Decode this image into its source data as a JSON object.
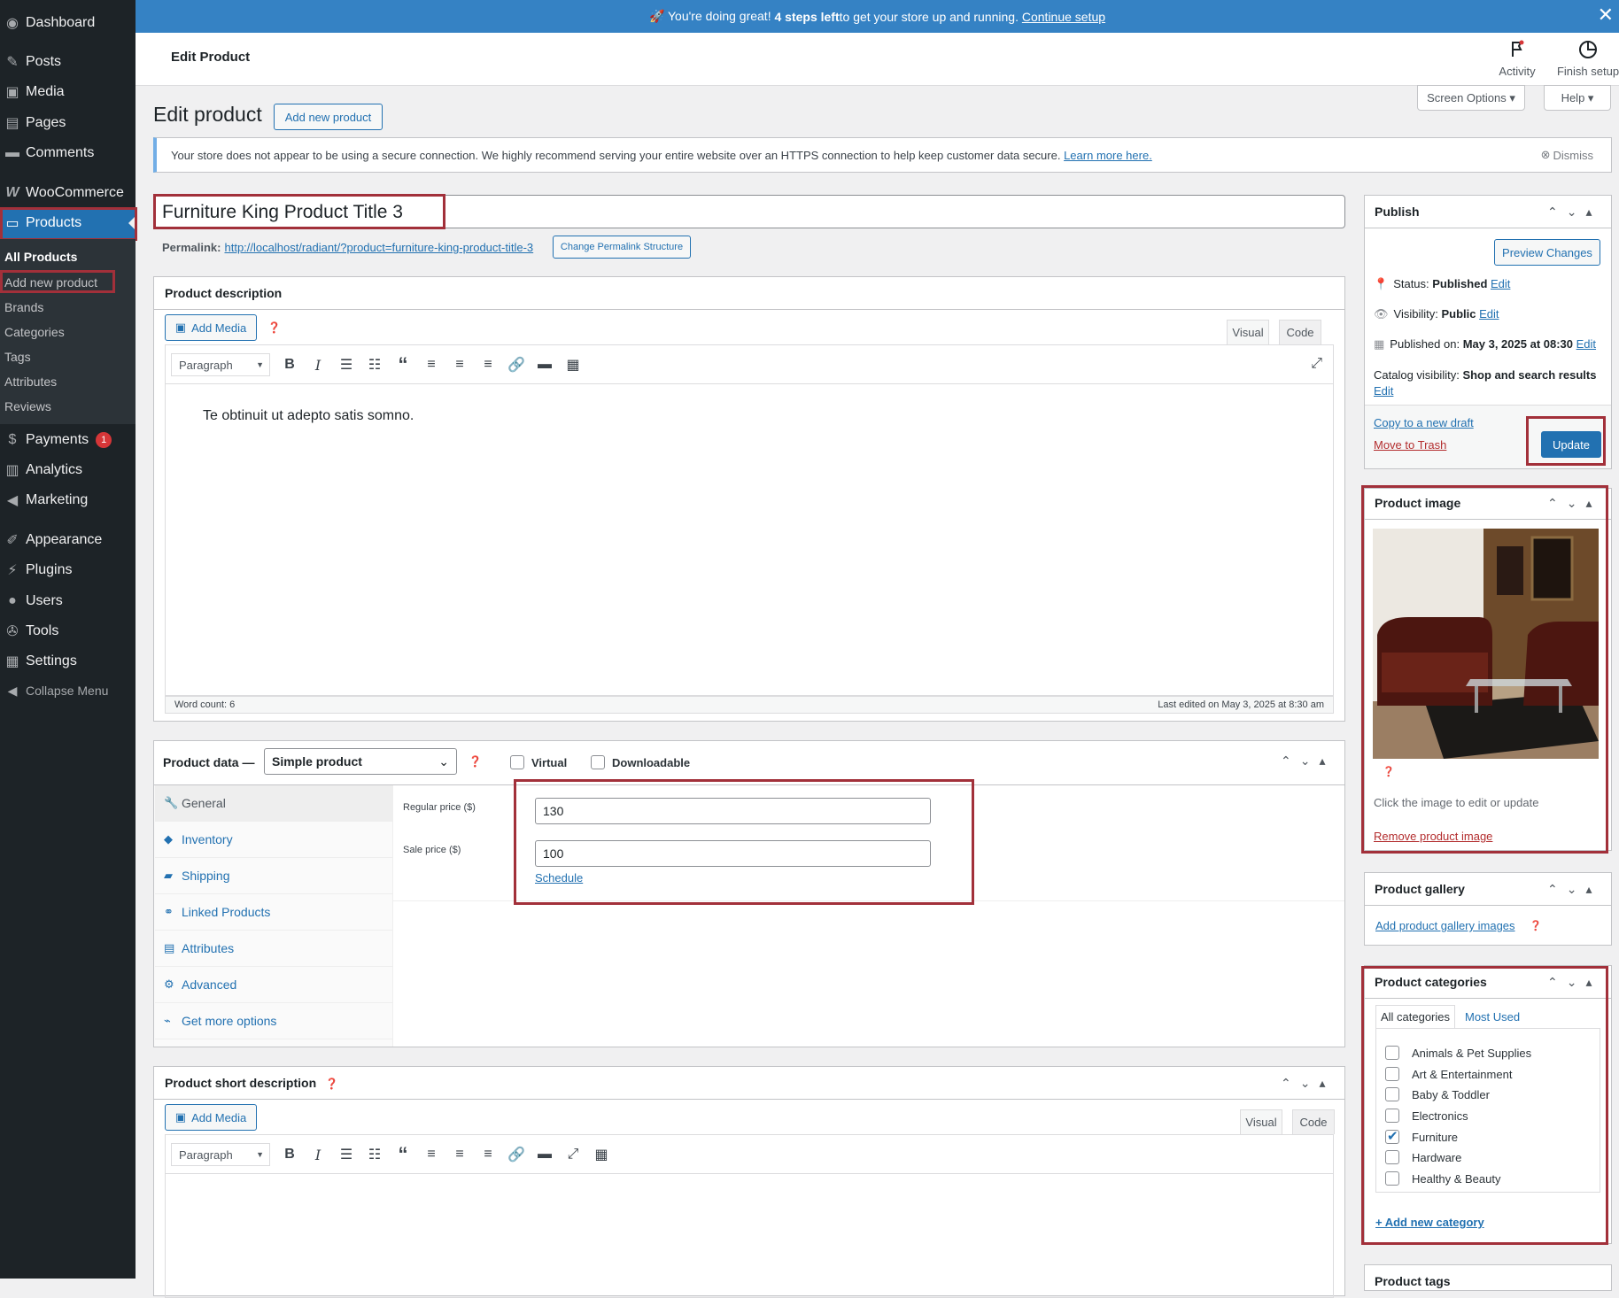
{
  "sidebar": {
    "items": [
      {
        "label": "Dashboard",
        "icon": "dashboard-icon"
      },
      {
        "label": "Posts",
        "icon": "pin-icon"
      },
      {
        "label": "Media",
        "icon": "media-icon"
      },
      {
        "label": "Pages",
        "icon": "pages-icon"
      },
      {
        "label": "Comments",
        "icon": "comments-icon"
      },
      {
        "label": "WooCommerce",
        "icon": "woocommerce-icon"
      },
      {
        "label": "Products",
        "icon": "products-icon"
      },
      {
        "label": "Payments",
        "icon": "payments-icon",
        "badge": "1"
      },
      {
        "label": "Analytics",
        "icon": "analytics-icon"
      },
      {
        "label": "Marketing",
        "icon": "megaphone-icon"
      },
      {
        "label": "Appearance",
        "icon": "brush-icon"
      },
      {
        "label": "Plugins",
        "icon": "plugin-icon"
      },
      {
        "label": "Users",
        "icon": "users-icon"
      },
      {
        "label": "Tools",
        "icon": "wrench-icon"
      },
      {
        "label": "Settings",
        "icon": "settings-icon"
      },
      {
        "label": "Collapse Menu",
        "icon": "collapse-icon"
      }
    ],
    "submenu": [
      "All Products",
      "Add new product",
      "Brands",
      "Categories",
      "Tags",
      "Attributes",
      "Reviews"
    ]
  },
  "banner": {
    "pre": "🚀 You're doing great! ",
    "bold": "4 steps left",
    "post": " to get your store up and running. ",
    "link": "Continue setup"
  },
  "header": {
    "title": "Edit Product",
    "activity": "Activity",
    "finish": "Finish setup",
    "screen_options": "Screen Options ▾",
    "help": "Help ▾"
  },
  "page": {
    "title": "Edit product",
    "add_new": "Add new product"
  },
  "notice": {
    "text": "Your store does not appear to be using a secure connection. We highly recommend serving your entire website over an HTTPS connection to help keep customer data secure. ",
    "link": "Learn more here.",
    "dismiss": "Dismiss"
  },
  "product": {
    "title": "Furniture King Product Title 3",
    "permalink_label": "Permalink:",
    "permalink": "http://localhost/radiant/?product=furniture-king-product-title-3",
    "change_permalink": "Change Permalink Structure"
  },
  "description": {
    "heading": "Product description",
    "add_media": "Add Media",
    "tab_visual": "Visual",
    "tab_code": "Code",
    "format": "Paragraph",
    "content": "Te obtinuit ut adepto satis somno.",
    "word_count": "Word count: 6",
    "last_edited": "Last edited on May 3, 2025 at 8:30 am"
  },
  "product_data": {
    "heading": "Product data —",
    "type": "Simple product",
    "virtual": "Virtual",
    "downloadable": "Downloadable",
    "tabs": [
      "General",
      "Inventory",
      "Shipping",
      "Linked Products",
      "Attributes",
      "Advanced",
      "Get more options"
    ],
    "regular_price_label": "Regular price ($)",
    "regular_price": "130",
    "sale_price_label": "Sale price ($)",
    "sale_price": "100",
    "schedule": "Schedule"
  },
  "short_description": {
    "heading": "Product short description",
    "add_media": "Add Media",
    "tab_visual": "Visual",
    "tab_code": "Code",
    "format": "Paragraph"
  },
  "publish": {
    "heading": "Publish",
    "preview": "Preview Changes",
    "status_label": "Status: ",
    "status": "Published",
    "edit": "Edit",
    "visibility_label": "Visibility: ",
    "visibility": "Public",
    "published_label": "Published on: ",
    "published": "May 3, 2025 at 08:30",
    "catalog_label": "Catalog visibility: ",
    "catalog": "Shop and search results",
    "copy": "Copy to a new draft",
    "trash": "Move to Trash",
    "update": "Update"
  },
  "product_image": {
    "heading": "Product image",
    "hint": "Click the image to edit or update",
    "remove": "Remove product image"
  },
  "gallery": {
    "heading": "Product gallery",
    "add": "Add product gallery images"
  },
  "categories": {
    "heading": "Product categories",
    "tab_all": "All categories",
    "tab_most": "Most Used",
    "items": [
      {
        "label": "Animals & Pet Supplies",
        "checked": false
      },
      {
        "label": "Art & Entertainment",
        "checked": false
      },
      {
        "label": "Baby & Toddler",
        "checked": false
      },
      {
        "label": "Electronics",
        "checked": false
      },
      {
        "label": "Furniture",
        "checked": true
      },
      {
        "label": "Hardware",
        "checked": false
      },
      {
        "label": "Healthy & Beauty",
        "checked": false
      }
    ],
    "add_new": "+ Add new category"
  },
  "tags": {
    "heading": "Product tags"
  },
  "colors": {
    "sidebar": "#1d2327",
    "accent": "#2271b1",
    "banner": "#3582c4",
    "highlight": "#a2303a"
  }
}
